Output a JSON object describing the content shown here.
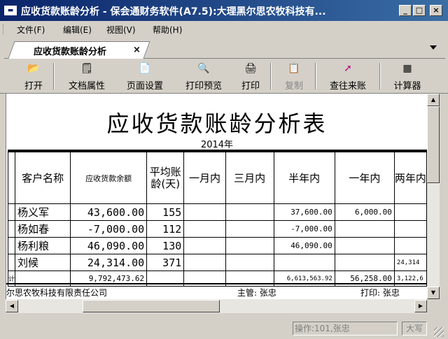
{
  "window": {
    "title": "应收货款账龄分析 - 保会通财务软件(A7.5):大理黑尔思农牧科技有...",
    "icon": "app-icon",
    "min_label": "_",
    "max_label": "□",
    "close_label": "×"
  },
  "menu": {
    "items": [
      "文件(F)",
      "编辑(E)",
      "视图(V)",
      "帮助(H)"
    ]
  },
  "tabs": {
    "active_label": "应收货款账龄分析",
    "close_label": "×"
  },
  "toolbar": {
    "buttons": [
      {
        "label": "打开",
        "icon": "folder-open-icon",
        "glyph": "📂",
        "enabled": true
      },
      {
        "label": "文档属性",
        "icon": "document-properties-icon",
        "glyph": "🗒",
        "enabled": true
      },
      {
        "label": "页面设置",
        "icon": "page-setup-icon",
        "glyph": "📄",
        "enabled": true
      },
      {
        "label": "打印预览",
        "icon": "print-preview-icon",
        "glyph": "🔍",
        "enabled": true
      },
      {
        "label": "打印",
        "icon": "printer-icon",
        "glyph": "🖨",
        "enabled": true
      },
      {
        "label": "复制",
        "icon": "copy-icon",
        "glyph": "📋",
        "enabled": false
      },
      {
        "label": "查往来账",
        "icon": "account-lookup-icon",
        "glyph": "➚",
        "enabled": true
      },
      {
        "label": "计算器",
        "icon": "calculator-icon",
        "glyph": "▦",
        "enabled": true
      }
    ]
  },
  "report": {
    "title": "应收货款账龄分析表",
    "year": "2014年",
    "headers": [
      "客户名称",
      "应收货款余额",
      "平均账龄(天)",
      "一月内",
      "三月内",
      "半年内",
      "一年内",
      "两年内"
    ],
    "rows": [
      {
        "name": "杨义军",
        "balance": "43,600.00",
        "days": "155",
        "m1": "",
        "m3": "",
        "half": "37,600.00",
        "year1": "6,000.00",
        "year2": ""
      },
      {
        "name": "杨如春",
        "balance": "-7,000.00",
        "days": "112",
        "m1": "",
        "m3": "",
        "half": "-7,000.00",
        "year1": "",
        "year2": ""
      },
      {
        "name": "杨利粮",
        "balance": "46,090.00",
        "days": "130",
        "m1": "",
        "m3": "",
        "half": "46,090.00",
        "year1": "",
        "year2": ""
      },
      {
        "name": "刘候",
        "balance": "24,314.00",
        "days": "371",
        "m1": "",
        "m3": "",
        "half": "",
        "year1": "",
        "year2": "24,314"
      }
    ],
    "total": {
      "name": "计",
      "balance": "9,792,473.62",
      "days": "",
      "m1": "",
      "m3": "",
      "half": "6,613,563.92",
      "year1": "56,258.00",
      "year2": "3,122,6"
    },
    "footer": {
      "company": "尔思农牧科技有限责任公司",
      "director": "主管: 张忠",
      "printer": "打印: 张忠"
    }
  },
  "status": {
    "operator": "操作:101,张忠",
    "caps": "大写"
  }
}
